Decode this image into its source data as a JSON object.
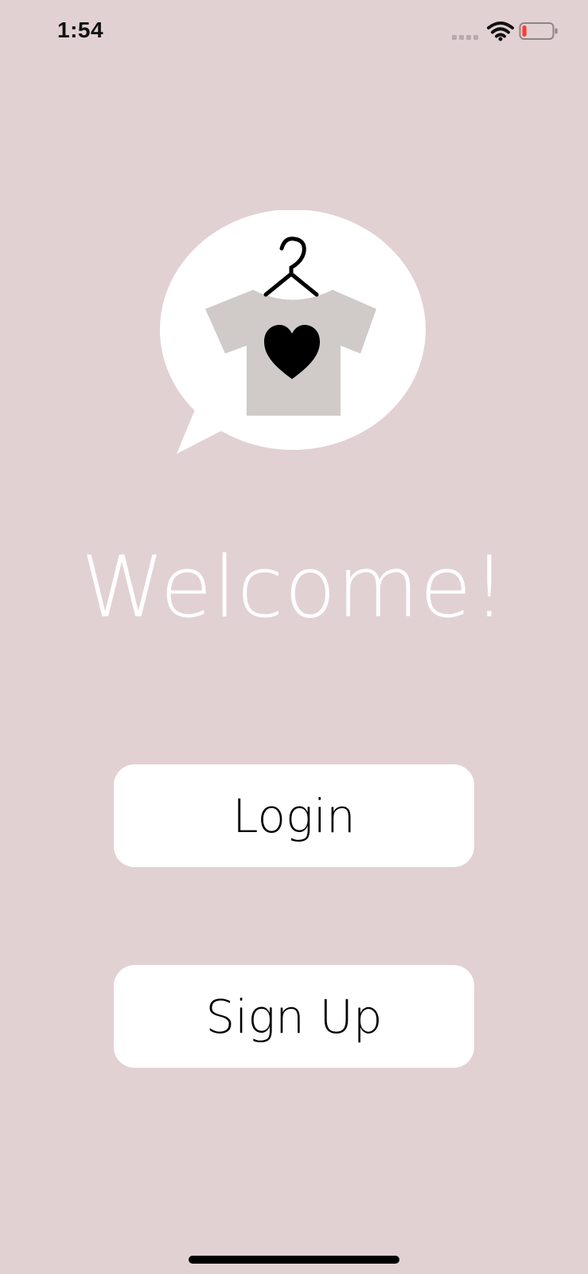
{
  "status_bar": {
    "time": "1:54",
    "signal_icon": "cellular-signal-icon",
    "wifi_icon": "wifi-icon",
    "battery_icon": "battery-low-icon",
    "battery_level_fraction": 0.1,
    "battery_color": "#ff3b30"
  },
  "logo": {
    "icon": "tshirt-heart-hanger-icon"
  },
  "welcome": {
    "title": "Welcome!"
  },
  "buttons": {
    "login_label": "Login",
    "signup_label": "Sign Up"
  },
  "colors": {
    "background": "#e2d1d3",
    "button_bg": "#ffffff",
    "shirt": "#d0cac9"
  }
}
